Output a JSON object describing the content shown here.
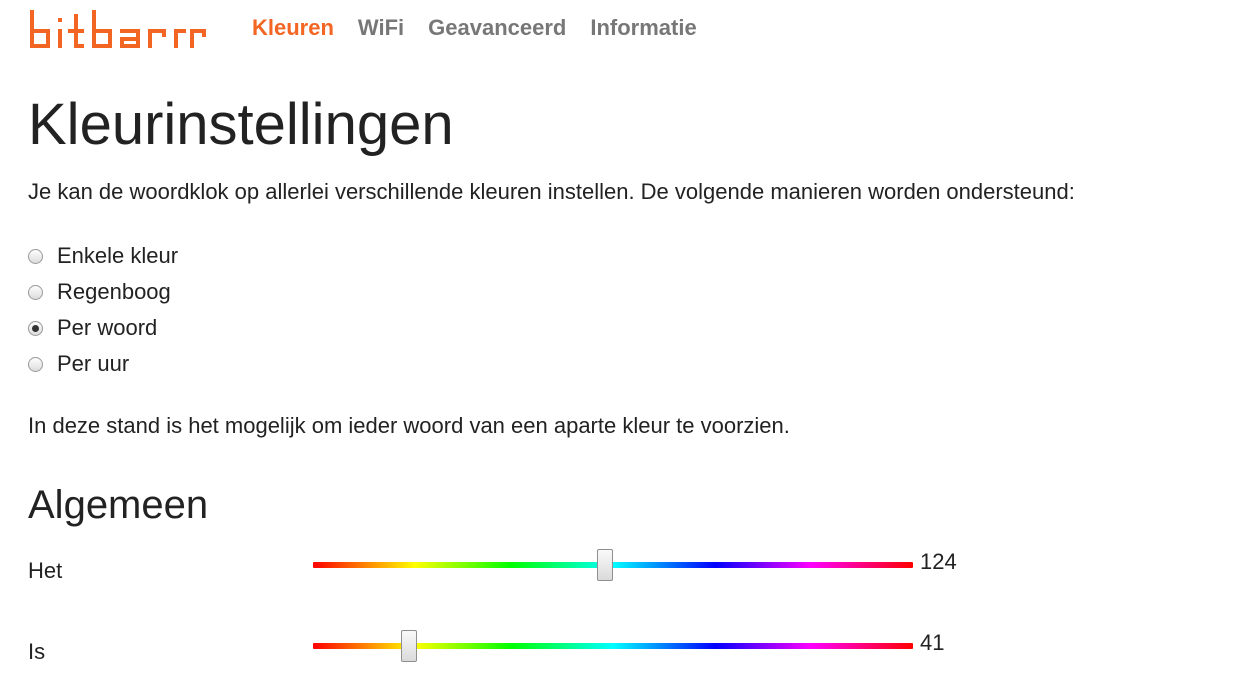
{
  "nav": {
    "logo_alt": "bitbar",
    "links": [
      {
        "label": "Kleuren",
        "active": true
      },
      {
        "label": "WiFi",
        "active": false
      },
      {
        "label": "Geavanceerd",
        "active": false
      },
      {
        "label": "Informatie",
        "active": false
      }
    ]
  },
  "page": {
    "title": "Kleurinstellingen",
    "intro": "Je kan de woordklok op allerlei verschillende kleuren instellen. De volgende manieren worden ondersteund:",
    "modes": [
      {
        "label": "Enkele kleur",
        "checked": false
      },
      {
        "label": "Regenboog",
        "checked": false
      },
      {
        "label": "Per woord",
        "checked": true
      },
      {
        "label": "Per uur",
        "checked": false
      }
    ],
    "mode_description": "In deze stand is het mogelijk om ieder woord van een aparte kleur te voorzien."
  },
  "section": {
    "title": "Algemeen",
    "sliders": [
      {
        "label": "Het",
        "value": 124,
        "min": 0,
        "max": 255
      },
      {
        "label": "Is",
        "value": 41,
        "min": 0,
        "max": 255
      }
    ]
  },
  "colors": {
    "accent": "#f26522",
    "nav_inactive": "#777777",
    "text": "#222222"
  }
}
